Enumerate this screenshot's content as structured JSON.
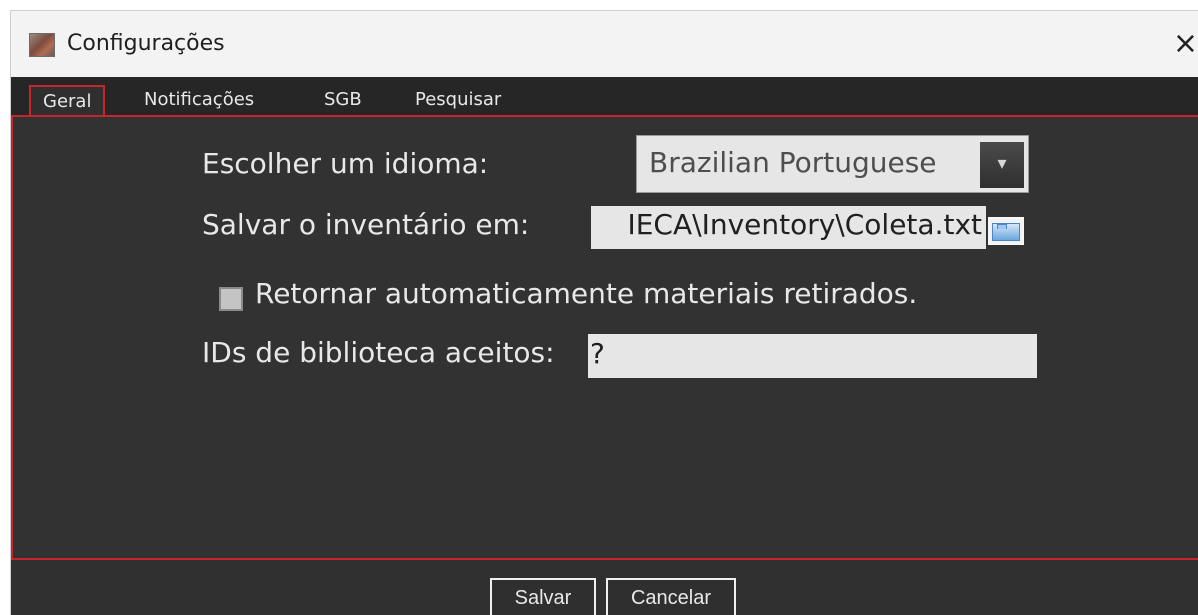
{
  "window": {
    "title": "Configurações",
    "close_symbol": "×"
  },
  "tabs": [
    {
      "label": "Geral",
      "active": true
    },
    {
      "label": "Notificações",
      "active": false
    },
    {
      "label": "SGB",
      "active": false
    },
    {
      "label": "Pesquisar",
      "active": false
    }
  ],
  "form": {
    "language_label": "Escolher um idioma:",
    "language_value": "Brazilian Portuguese",
    "save_inventory_label": "Salvar o inventário em:",
    "save_inventory_value": "IECA\\Inventory\\Coleta.txt",
    "auto_return_label": "Retornar automaticamente materiais retirados.",
    "accepted_library_ids_label": "IDs de biblioteca aceitos:",
    "accepted_library_ids_value": "?"
  },
  "footer": {
    "save_label": "Salvar",
    "cancel_label": "Cancelar"
  },
  "icons": {
    "app": "app-icon",
    "dropdown": "chevron-down-icon",
    "folder": "folder-icon",
    "close": "close-icon"
  },
  "colors": {
    "accent_red": "#c5262c",
    "panel_bg": "#323232",
    "tabs_bg": "#262626",
    "input_bg": "#e6e6e6"
  }
}
